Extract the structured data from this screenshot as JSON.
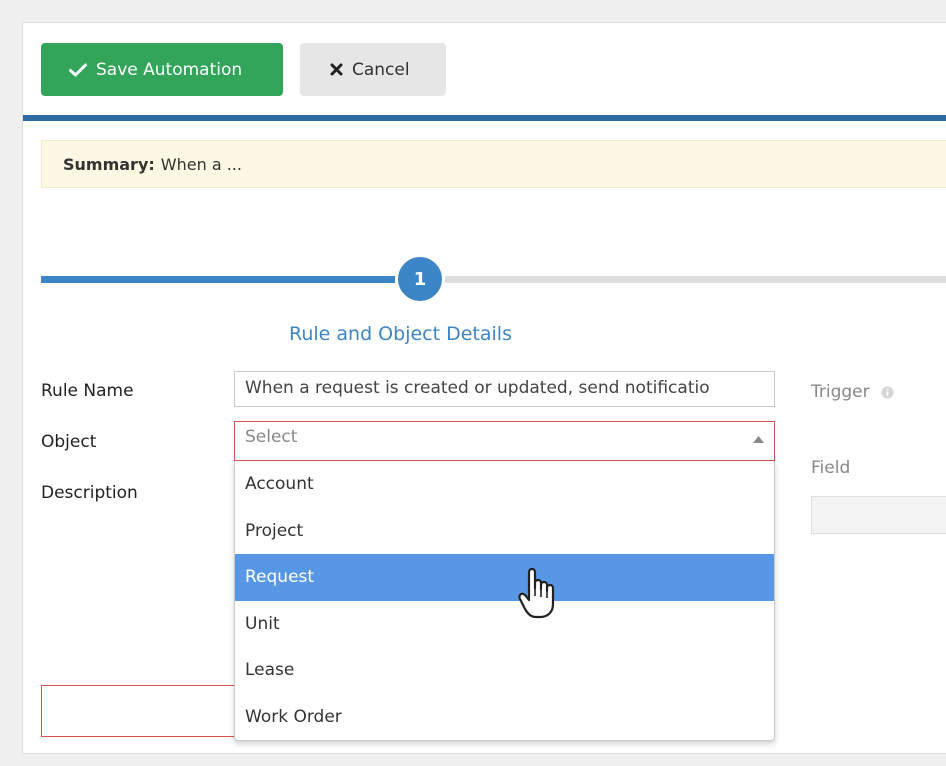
{
  "toolbar": {
    "save_label": "Save Automation",
    "save_icon": "check-icon",
    "cancel_label": "Cancel",
    "cancel_icon": "close-icon"
  },
  "summary": {
    "prefix": "Summary:",
    "text": "When a ..."
  },
  "stepper": {
    "step_number": "1",
    "step_title": "Rule and Object Details"
  },
  "form": {
    "rule_name_label": "Rule Name",
    "rule_name_value": "When a request is created or updated, send notificatio",
    "object_label": "Object",
    "object_placeholder": "Select",
    "description_label": "Description",
    "object_options": [
      "Account",
      "Project",
      "Request",
      "Unit",
      "Lease",
      "Work Order"
    ],
    "highlighted_option": "Request"
  },
  "right_panel": {
    "trigger_label": "Trigger",
    "field_label": "Field"
  },
  "colors": {
    "save_button": "#33a55a",
    "accent_blue": "#3c85c6",
    "option_highlight": "#5897e5",
    "error_border": "#d9534f",
    "summary_bg": "#fcf8e3"
  }
}
